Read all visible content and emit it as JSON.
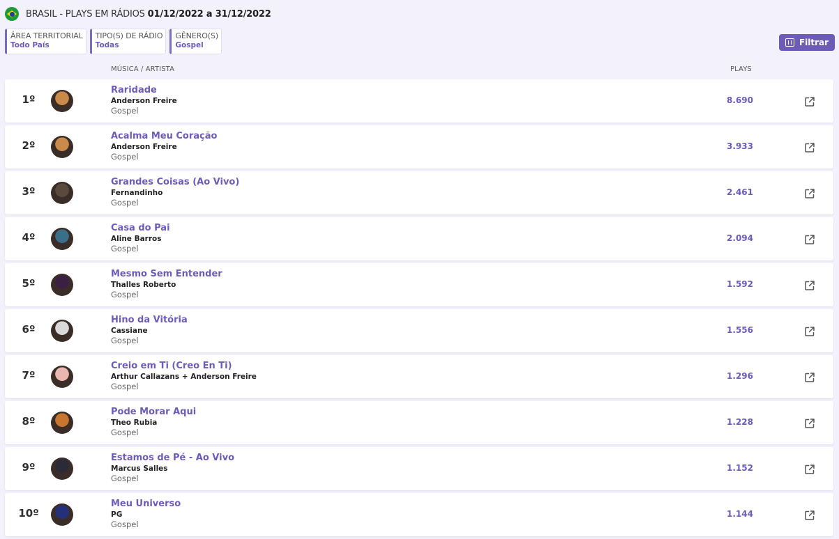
{
  "header": {
    "flag_icon": "brazil-flag-icon",
    "title": "BRASIL - PLAYS EM RÁDIOS",
    "period": "01/12/2022 a 31/12/2022"
  },
  "filters": [
    {
      "label": "ÁREA TERRITORIAL",
      "value": "Todo País"
    },
    {
      "label": "TIPO(S) DE RÁDIO",
      "value": "Todas"
    },
    {
      "label": "GÊNERO(S)",
      "value": "Gospel"
    }
  ],
  "filter_button": {
    "label": "Filtrar",
    "icon": "sliders-icon"
  },
  "columns": {
    "song": "MÚSICA / ARTISTA",
    "plays": "PLAYS"
  },
  "colors": {
    "accent": "#6d5bb8",
    "background": "#f3f1fb"
  },
  "rows": [
    {
      "rank": "1º",
      "song": "Raridade",
      "artist": "Anderson Freire",
      "genre": "Gospel",
      "plays": "8.690",
      "avatar_color": "#c98a4a"
    },
    {
      "rank": "2º",
      "song": "Acalma Meu Coração",
      "artist": "Anderson Freire",
      "genre": "Gospel",
      "plays": "3.933",
      "avatar_color": "#c98a4a"
    },
    {
      "rank": "3º",
      "song": "Grandes Coisas (Ao Vivo)",
      "artist": "Fernandinho",
      "genre": "Gospel",
      "plays": "2.461",
      "avatar_color": "#5a4a3e"
    },
    {
      "rank": "4º",
      "song": "Casa do Pai",
      "artist": "Aline Barros",
      "genre": "Gospel",
      "plays": "2.094",
      "avatar_color": "#3a6f8a"
    },
    {
      "rank": "5º",
      "song": "Mesmo Sem Entender",
      "artist": "Thalles Roberto",
      "genre": "Gospel",
      "plays": "1.592",
      "avatar_color": "#3b2044"
    },
    {
      "rank": "6º",
      "song": "Hino da Vitória",
      "artist": "Cassiane",
      "genre": "Gospel",
      "plays": "1.556",
      "avatar_color": "#d9d9d9"
    },
    {
      "rank": "7º",
      "song": "Creio em Ti (Creo En Ti)",
      "artist": "Arthur Callazans + Anderson Freire",
      "genre": "Gospel",
      "plays": "1.296",
      "avatar_color": "#e8b8b0"
    },
    {
      "rank": "8º",
      "song": "Pode Morar Aqui",
      "artist": "Theo Rubia",
      "genre": "Gospel",
      "plays": "1.228",
      "avatar_color": "#c8762f"
    },
    {
      "rank": "9º",
      "song": "Estamos de Pé - Ao Vivo",
      "artist": "Marcus Salles",
      "genre": "Gospel",
      "plays": "1.152",
      "avatar_color": "#2a2a38"
    },
    {
      "rank": "10º",
      "song": "Meu Universo",
      "artist": "PG",
      "genre": "Gospel",
      "plays": "1.144",
      "avatar_color": "#24307a"
    }
  ],
  "row_action_icon": "external-link-icon"
}
